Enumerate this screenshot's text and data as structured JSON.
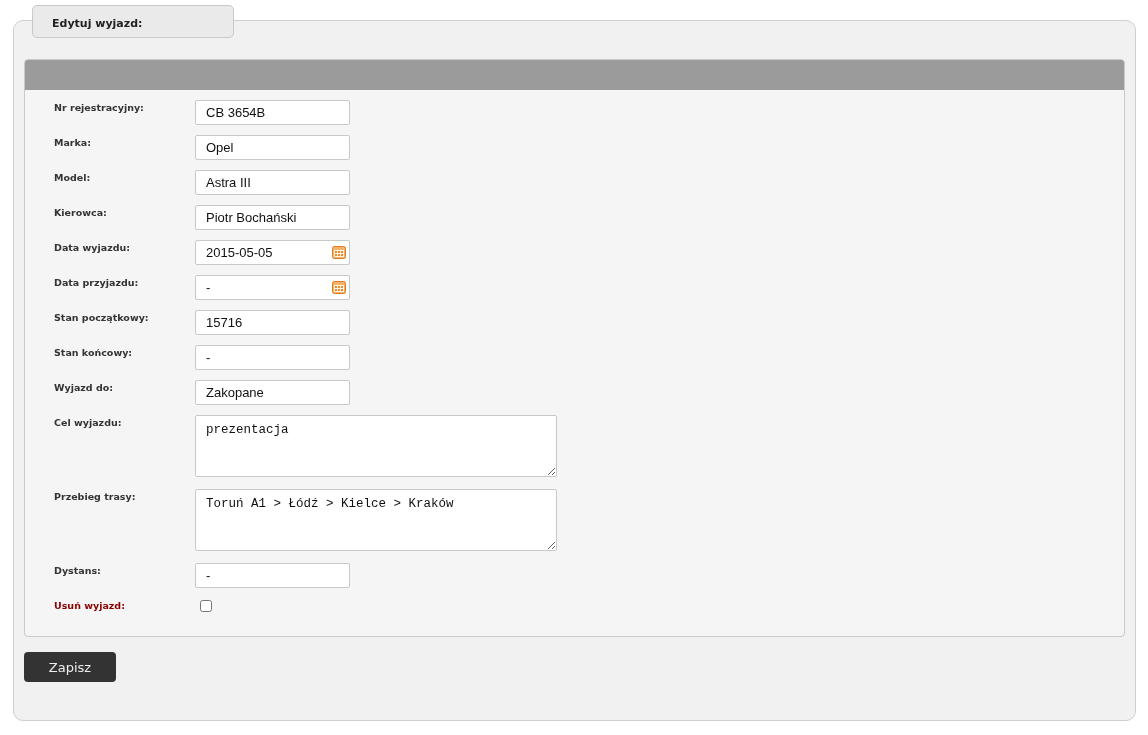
{
  "legend": "Edytuj wyjazd:",
  "fields": [
    {
      "kind": "text",
      "label": "Nr rejestracyjny:",
      "value": "CB 3654B"
    },
    {
      "kind": "text",
      "label": "Marka:",
      "value": "Opel"
    },
    {
      "kind": "text",
      "label": "Model:",
      "value": "Astra III"
    },
    {
      "kind": "text",
      "label": "Kierowca:",
      "value": "Piotr Bochański"
    },
    {
      "kind": "date",
      "label": "Data wyjazdu:",
      "value": "2015-05-05"
    },
    {
      "kind": "date",
      "label": "Data przyjazdu:",
      "value": "-"
    },
    {
      "kind": "text",
      "label": "Stan początkowy:",
      "value": "15716"
    },
    {
      "kind": "text",
      "label": "Stan końcowy:",
      "value": "-"
    },
    {
      "kind": "text",
      "label": "Wyjazd do:",
      "value": "Zakopane"
    },
    {
      "kind": "textarea",
      "label": "Cel wyjazdu:",
      "value": "prezentacja"
    },
    {
      "kind": "textarea",
      "label": "Przebieg trasy:",
      "value": "Toruń A1 > Łódź > Kielce > Kraków"
    },
    {
      "kind": "text",
      "label": "Dystans:",
      "value": "-"
    },
    {
      "kind": "checkbox",
      "label": "Usuń wyjazd:",
      "checked": false
    }
  ],
  "submit": "Zapisz"
}
